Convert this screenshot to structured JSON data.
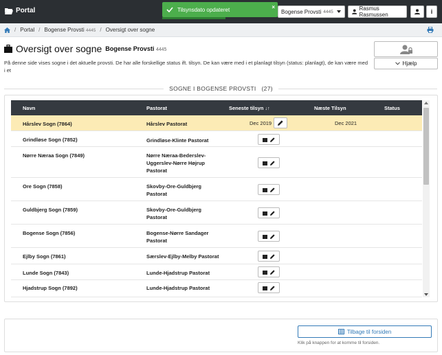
{
  "navbar": {
    "brand": "Portal",
    "provsti_select": "Bogense Provsti",
    "provsti_number": "4445",
    "user": "Rasmus Rasmussen",
    "info_label": "i"
  },
  "toast": {
    "message": "Tilsynsdato opdateret",
    "close": "×",
    "color": "#4cae4c"
  },
  "breadcrumb": {
    "items": [
      "Portal",
      "Bogense Provsti",
      "Oversigt over sogne"
    ],
    "provsti_number": "4445",
    "separator": "/"
  },
  "header": {
    "title": "Oversigt over sogne",
    "subtitle": "Bogense Provsti",
    "subtitle_number": "4445",
    "intro": "På denne side vises sogne i det aktuelle provsti. De har alle forskellige status ift. tilsyn. De kan være med i et planlagt tilsyn (status: planlagt), de kan være med i et",
    "help_label": "Hjælp"
  },
  "section": {
    "label": "SOGNE I BOGENSE PROVSTI",
    "count": "(27)"
  },
  "table": {
    "columns": [
      "Navn",
      "Pastorat",
      "Seneste tilsyn",
      "Næste Tilsyn",
      "Status"
    ],
    "sort_icon": "↓↑",
    "rows": [
      {
        "name": "Hårslev Sogn (7864)",
        "pastorat": [
          "Hårslev Pastorat"
        ],
        "seneste": "Dec 2019",
        "naeste": "Dec 2021",
        "status": ""
      },
      {
        "name": "Grindløse Sogn (7852)",
        "pastorat": [
          "Grindløse-Klinte Pastorat"
        ],
        "seneste": "",
        "naeste": "",
        "status": ""
      },
      {
        "name": "Nørre Næraa Sogn (7849)",
        "pastorat": [
          "Nørre Næraa-Bederslev-",
          "Uggerslev-Nørre Højrup",
          "Pastorat"
        ],
        "seneste": "",
        "naeste": "",
        "status": ""
      },
      {
        "name": "Ore Sogn (7858)",
        "pastorat": [
          "Skovby-Ore-Guldbjerg",
          "Pastorat"
        ],
        "seneste": "",
        "naeste": "",
        "status": ""
      },
      {
        "name": "Guldbjerg Sogn (7859)",
        "pastorat": [
          "Skovby-Ore-Guldbjerg",
          "Pastorat"
        ],
        "seneste": "",
        "naeste": "",
        "status": ""
      },
      {
        "name": "Bogense Sogn (7856)",
        "pastorat": [
          "Bogense-Nørre Sandager",
          "Pastorat"
        ],
        "seneste": "",
        "naeste": "",
        "status": ""
      },
      {
        "name": "Ejlby Sogn (7861)",
        "pastorat": [
          "Særslev-Ejlby-Melby Pastorat"
        ],
        "seneste": "",
        "naeste": "",
        "status": ""
      },
      {
        "name": "Lunde Sogn (7843)",
        "pastorat": [
          "Lunde-Hjadstrup Pastorat"
        ],
        "seneste": "",
        "naeste": "",
        "status": ""
      },
      {
        "name": "Hjadstrup Sogn (7892)",
        "pastorat": [
          "Lunde-Hjadstrup Pastorat"
        ],
        "seneste": "",
        "naeste": "",
        "status": ""
      }
    ]
  },
  "footer": {
    "back_label": "Tilbage til forsiden",
    "hint": "Klik på knappen for at komme til forsiden."
  },
  "colors": {
    "navbar": "#2b2f33",
    "table_header": "#353a40",
    "highlight_row": "#fcebb5",
    "link_blue": "#337ab7"
  }
}
